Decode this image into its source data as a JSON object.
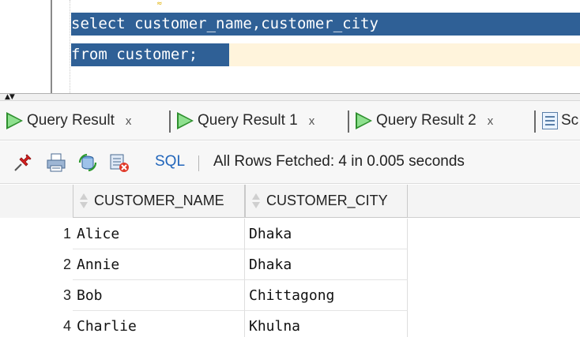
{
  "editor": {
    "line1": "select customer_name,customer_city",
    "line2": "from customer;",
    "warning_mark": "≈"
  },
  "splitter": {
    "arrows": "▲▼"
  },
  "tabs": [
    {
      "label": "Query Result",
      "close": "x"
    },
    {
      "label": "Query Result 1",
      "close": "x"
    },
    {
      "label": "Query Result 2",
      "close": "x"
    },
    {
      "label": "Sc"
    }
  ],
  "toolbar": {
    "sql_label": "SQL",
    "status": "All Rows Fetched: 4 in 0.005 seconds"
  },
  "grid": {
    "columns": [
      "CUSTOMER_NAME",
      "CUSTOMER_CITY"
    ],
    "rows": [
      {
        "num": "1",
        "name": "Alice",
        "city": "Dhaka"
      },
      {
        "num": "2",
        "name": "Annie",
        "city": "Dhaka"
      },
      {
        "num": "3",
        "name": "Bob",
        "city": "Chittagong"
      },
      {
        "num": "4",
        "name": "Charlie",
        "city": "Khulna"
      }
    ]
  },
  "colors": {
    "selection": "#2f6096",
    "current_line": "#fff4dc",
    "run_icon": "#48b848",
    "sql_link": "#2266bb"
  },
  "icons": [
    "pin-icon",
    "print-icon",
    "refresh-icon",
    "clear-icon",
    "run-query-icon",
    "sort-icon",
    "worksheet-icon"
  ]
}
